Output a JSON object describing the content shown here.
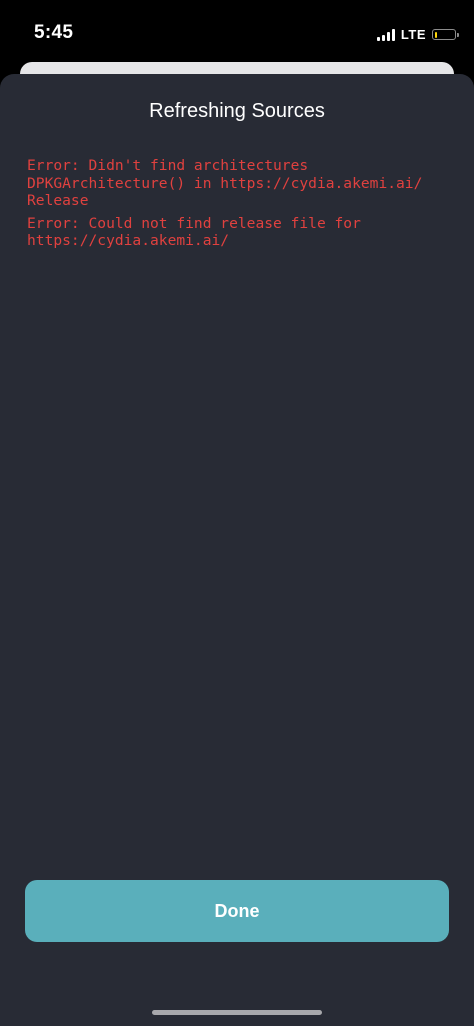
{
  "status_bar": {
    "time": "5:45",
    "network": "LTE",
    "battery_level": 0.12,
    "battery_color": "#ffd60a"
  },
  "sheet": {
    "title": "Refreshing Sources",
    "log": {
      "error1": {
        "line1": "Error: Didn't find architectures",
        "line2": "DPKGArchitecture() in https://cydia.akemi.ai/",
        "line3": "Release"
      },
      "error2": {
        "line1": "Error: Could not find release file for",
        "line2": "https://cydia.akemi.ai/"
      },
      "text_color": "#e0413f"
    },
    "done_label": "Done",
    "done_color": "#5aafbb",
    "background_color": "#282b35"
  }
}
